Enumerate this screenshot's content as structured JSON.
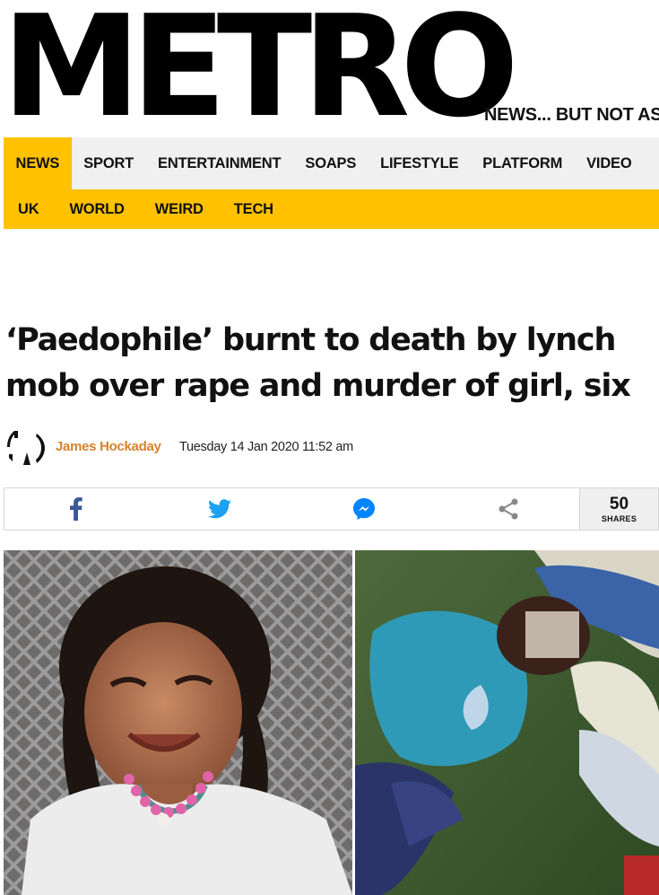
{
  "masthead": {
    "logo_text": "METRO",
    "tagline": "NEWS... BUT NOT AS"
  },
  "nav_primary": {
    "items": [
      {
        "label": "NEWS",
        "active": true
      },
      {
        "label": "SPORT",
        "active": false
      },
      {
        "label": "ENTERTAINMENT",
        "active": false
      },
      {
        "label": "SOAPS",
        "active": false
      },
      {
        "label": "LIFESTYLE",
        "active": false
      },
      {
        "label": "PLATFORM",
        "active": false
      },
      {
        "label": "VIDEO",
        "active": false
      }
    ]
  },
  "nav_secondary": {
    "items": [
      {
        "label": "UK"
      },
      {
        "label": "WORLD"
      },
      {
        "label": "WEIRD"
      },
      {
        "label": "TECH"
      }
    ]
  },
  "article": {
    "headline": "‘Paedophile’ burnt to death by lynch mob over rape and murder of girl, six",
    "author": "James Hockaday",
    "published": "Tuesday 14 Jan 2020 11:52 am"
  },
  "share": {
    "buttons": [
      {
        "icon": "facebook-icon",
        "color": "#3b5998"
      },
      {
        "icon": "twitter-icon",
        "color": "#1da1f2"
      },
      {
        "icon": "messenger-icon",
        "color": "#0084ff"
      },
      {
        "icon": "share-icon",
        "color": "#888888"
      }
    ],
    "count": "50",
    "count_label": "SHARES"
  },
  "colors": {
    "brand_yellow": "#ffc100",
    "nav_background": "#f0f0f0",
    "author_orange": "#d5822b"
  },
  "images": [
    {
      "name": "photo-girl"
    },
    {
      "name": "photo-scene"
    }
  ]
}
